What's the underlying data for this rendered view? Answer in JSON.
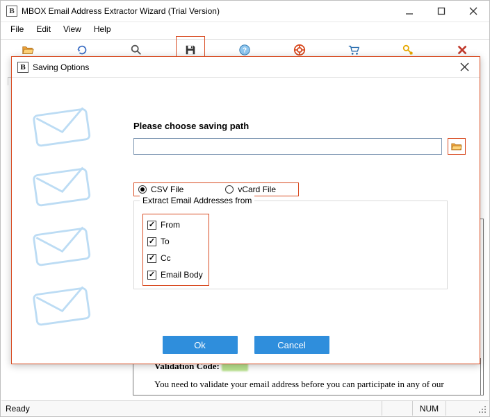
{
  "window": {
    "title": "MBOX Email Address Extractor Wizard (Trial Version)"
  },
  "menu": {
    "file": "File",
    "edit": "Edit",
    "view": "View",
    "help": "Help"
  },
  "toolbar_icons": {
    "open": "folder-open-icon",
    "refresh": "refresh-icon",
    "search": "search-icon",
    "save": "save-icon",
    "help": "help-icon",
    "support": "support-icon",
    "cart": "cart-icon",
    "key": "key-icon",
    "close": "close-icon"
  },
  "dialog": {
    "title": "Saving Options",
    "heading": "Please choose saving path",
    "path_value": "",
    "format_csv": "CSV File",
    "format_vcard": "vCard File",
    "group_legend": "Extract Email Addresses from",
    "chk_from": "From",
    "chk_to": "To",
    "chk_cc": "Cc",
    "chk_body": "Email Body",
    "ok": "Ok",
    "cancel": "Cancel"
  },
  "background": {
    "validation_label": "Validation Code:",
    "instruction": "You need to validate your email address before you can participate in any of our"
  },
  "statusbar": {
    "ready": "Ready",
    "num": "NUM"
  }
}
